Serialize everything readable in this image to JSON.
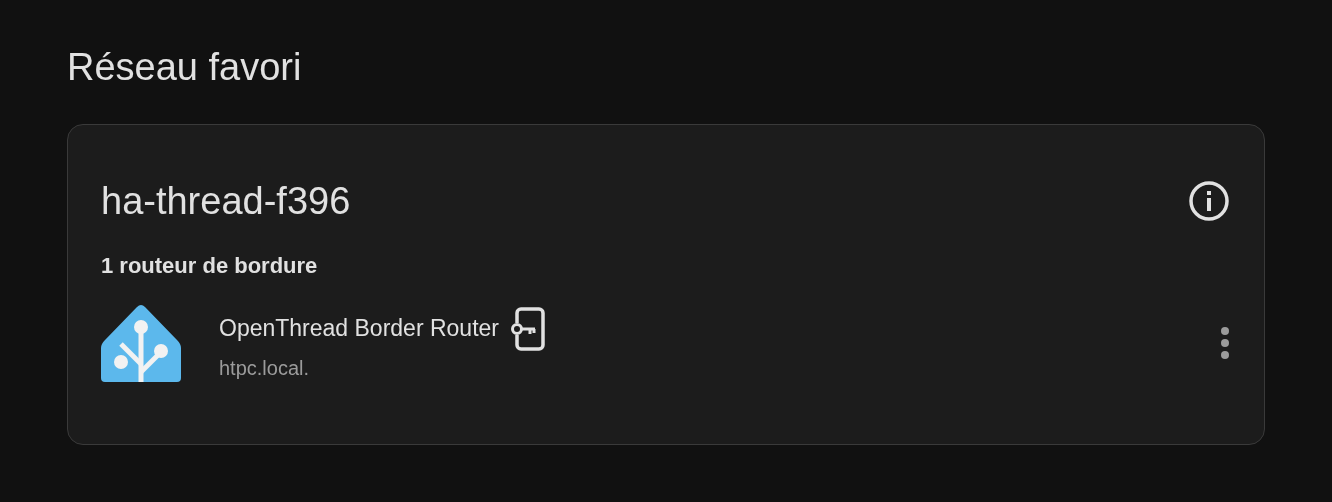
{
  "page_title": "Réseau favori",
  "network": {
    "name": "ha-thread-f396",
    "section_title": "1 routeur de bordure",
    "routers": [
      {
        "name": "OpenThread Border Router",
        "host": "htpc.local.",
        "has_credentials": true
      }
    ]
  }
}
